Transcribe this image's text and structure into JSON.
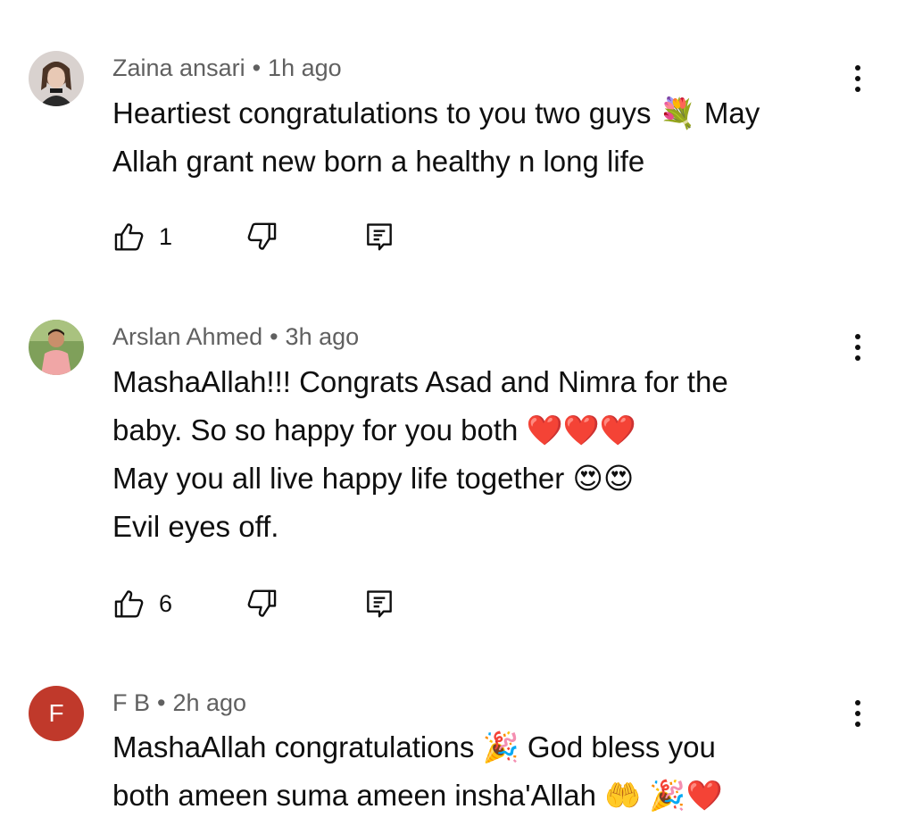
{
  "comments": [
    {
      "author": "Zaina ansari",
      "separator": "•",
      "time": "1h ago",
      "lines": [
        "Heartiest congratulations to you two guys 💐 May",
        "Allah grant new born a healthy n long life"
      ],
      "likes": "1"
    },
    {
      "author": "Arslan Ahmed",
      "separator": "•",
      "time": "3h ago",
      "lines": [
        "MashaAllah!!! Congrats Asad and Nimra for the",
        "baby. So so happy for you both ❤️❤️❤️",
        "May you all live happy life together 😍😍",
        "Evil eyes off."
      ],
      "likes": "6"
    },
    {
      "author": "F B",
      "avatar_letter": "F",
      "avatar_color": "#c0392b",
      "separator": "•",
      "time": "2h ago",
      "lines": [
        "MashaAllah congratulations 🎉 God bless you",
        "both ameen suma ameen insha'Allah 🤲 🎉❤️"
      ]
    }
  ],
  "icons": {
    "like": "thumbs-up-icon",
    "dislike": "thumbs-down-icon",
    "reply": "reply-comment-icon",
    "more": "more-vertical-icon"
  }
}
